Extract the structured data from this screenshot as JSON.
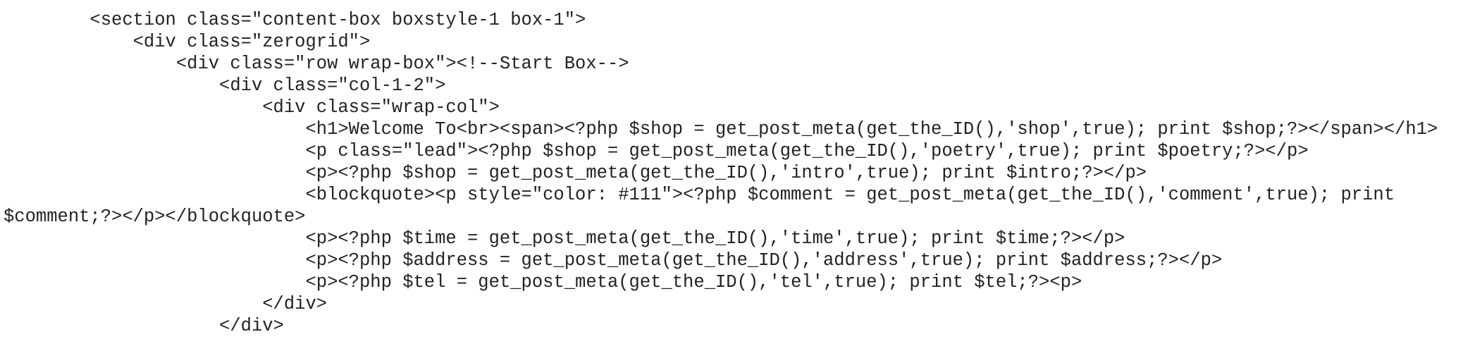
{
  "code_view": {
    "lines": [
      "        <section class=\"content-box boxstyle-1 box-1\">",
      "            <div class=\"zerogrid\">",
      "                <div class=\"row wrap-box\"><!--Start Box-->",
      "                    <div class=\"col-1-2\">",
      "                        <div class=\"wrap-col\">",
      "                            <h1>Welcome To<br><span><?php $shop = get_post_meta(get_the_ID(),'shop',true); print $shop;?></span></h1>",
      "                            <p class=\"lead\"><?php $shop = get_post_meta(get_the_ID(),'poetry',true); print $poetry;?></p>",
      "                            <p><?php $shop = get_post_meta(get_the_ID(),'intro',true); print $intro;?></p>",
      "                            <blockquote><p style=\"color: #111\"><?php $comment = get_post_meta(get_the_ID(),'comment',true); print",
      "$comment;?></p></blockquote>",
      "                            <p><?php $time = get_post_meta(get_the_ID(),'time',true); print $time;?></p>",
      "                            <p><?php $address = get_post_meta(get_the_ID(),'address',true); print $address;?></p>",
      "                            <p><?php $tel = get_post_meta(get_the_ID(),'tel',true); print $tel;?><p>",
      "                        </div>",
      "                    </div>"
    ]
  }
}
